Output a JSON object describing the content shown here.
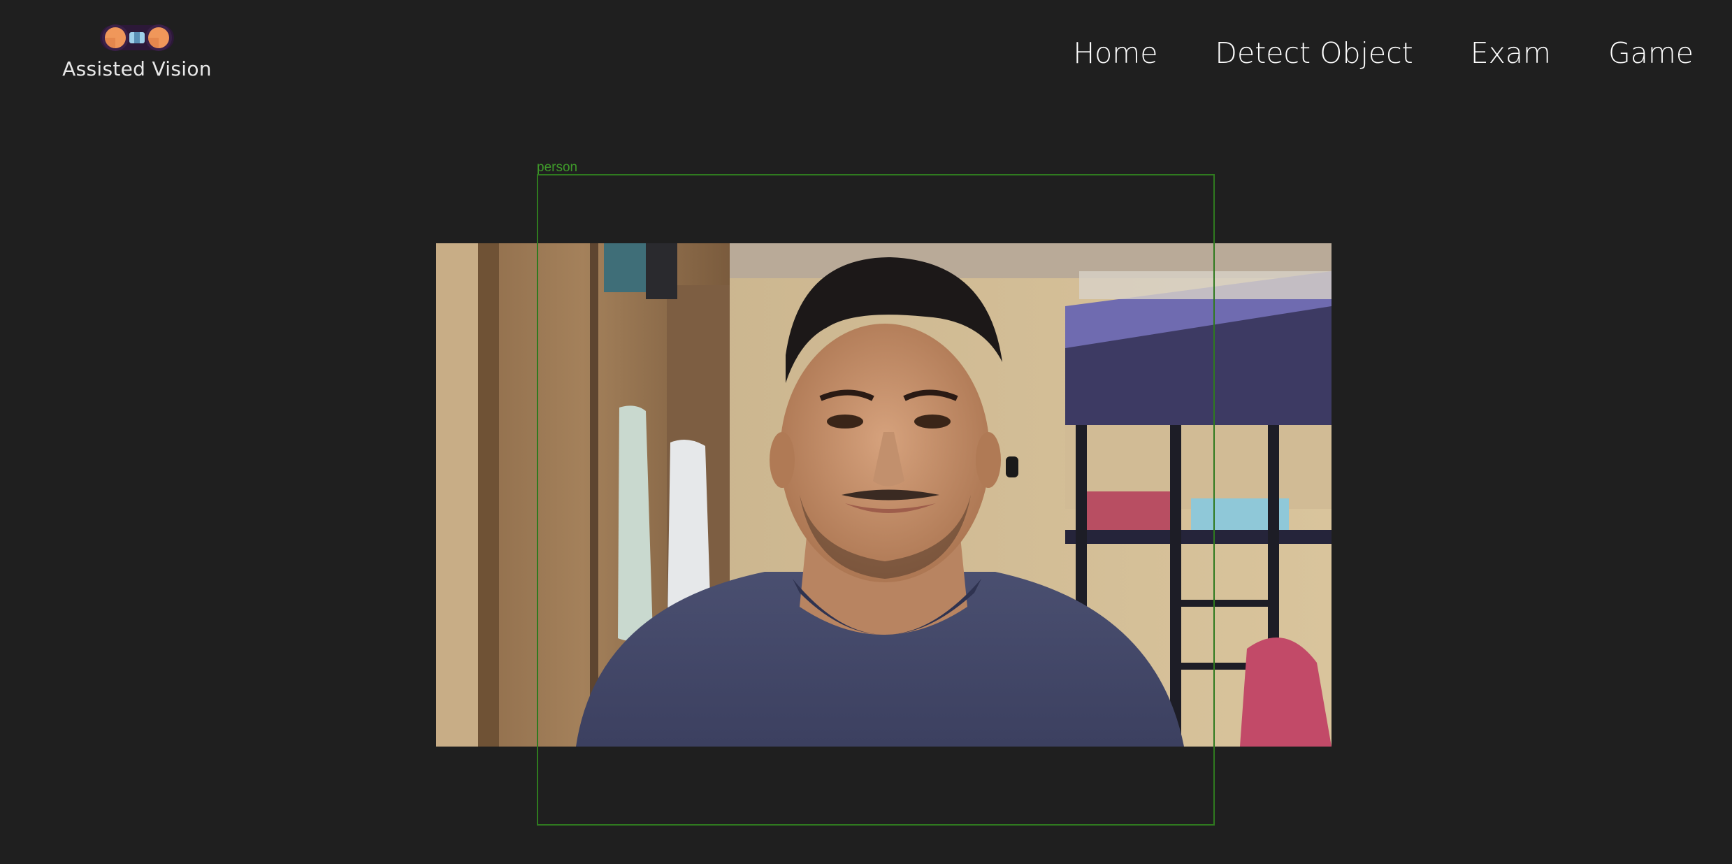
{
  "brand": {
    "name": "Assisted Vision",
    "logo_icon": "binoculars-icon",
    "colors": {
      "lens": "#f0975a",
      "body": "#3a2048",
      "bridge": "#9fd0ea"
    }
  },
  "nav": {
    "items": [
      {
        "label": "Home"
      },
      {
        "label": "Detect Object"
      },
      {
        "label": "Exam"
      },
      {
        "label": "Game"
      }
    ]
  },
  "video": {
    "icon": "webcam-feed-image"
  },
  "detection": {
    "label": "person",
    "color": "#2f7a1f"
  },
  "theme": {
    "background": "#1f1f1f",
    "nav_text": "#ffffff"
  }
}
